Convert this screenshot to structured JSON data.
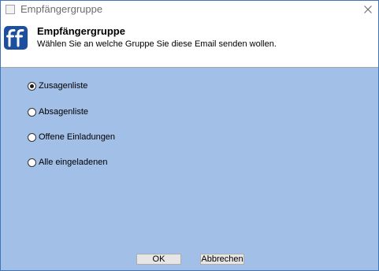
{
  "window": {
    "title": "Empfängergruppe"
  },
  "header": {
    "title": "Empfängergruppe",
    "subtitle": "Wählen Sie an welche Gruppe Sie diese Email senden wollen."
  },
  "options": [
    {
      "label": "Zusagenliste",
      "selected": true
    },
    {
      "label": "Absagenliste",
      "selected": false
    },
    {
      "label": "Offene Einladungen",
      "selected": false
    },
    {
      "label": "Alle eingeladenen",
      "selected": false
    }
  ],
  "buttons": {
    "ok": "OK",
    "cancel": "Abbrechen"
  },
  "colors": {
    "dialog_background": "#a2bfe8",
    "logo": "#1c4f9e",
    "window_border": "#3f76b8"
  },
  "icons": {
    "app": "app-icon",
    "close": "close-icon",
    "logo": "ff-logo-icon"
  }
}
